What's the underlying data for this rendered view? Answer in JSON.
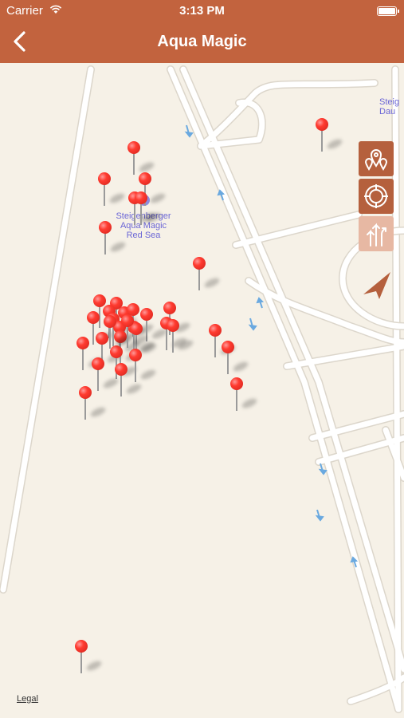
{
  "status_bar": {
    "carrier": "Carrier",
    "time": "3:13 PM"
  },
  "nav": {
    "title": "Aqua Magic"
  },
  "map": {
    "poi_label": [
      "Steigenberger",
      "Aqua Magic",
      "Red Sea"
    ],
    "edge_label": [
      "Steig",
      "Dau"
    ],
    "legal": "Legal",
    "pin_count": 36
  },
  "tools": {
    "nearby": "map-pins-icon",
    "locate": "crosshair-icon",
    "route": "road-arrows-icon",
    "compass": "location-arrow-icon"
  },
  "colors": {
    "header": "#c2633e",
    "pin": "#ff3b30",
    "map_background": "#f6f1e7",
    "road": "#ffffff",
    "poi_text": "#6b66d6"
  }
}
